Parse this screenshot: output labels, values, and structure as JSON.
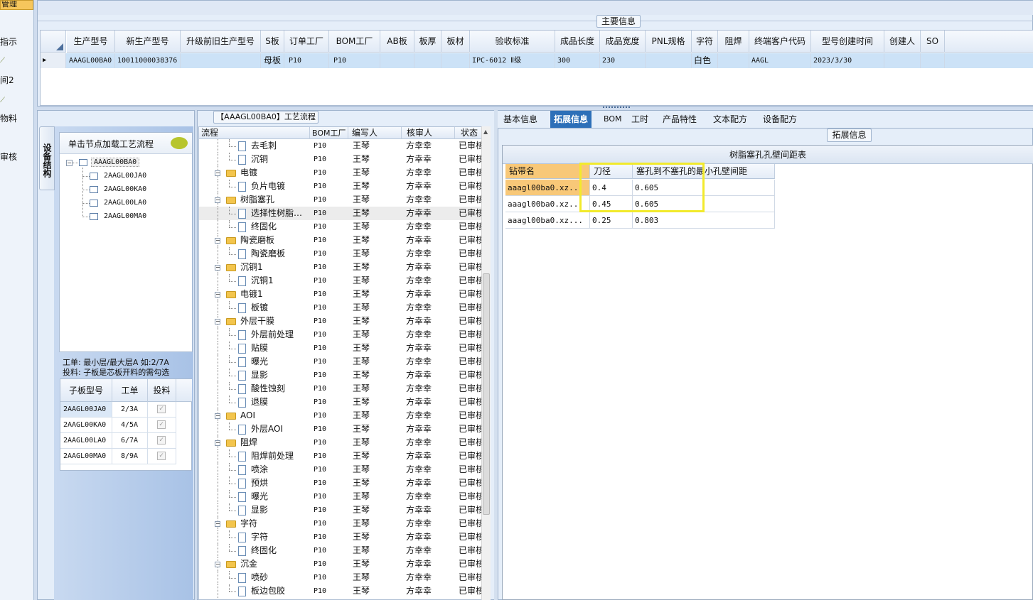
{
  "leftnav": {
    "top_label": "管理",
    "items": [
      "指示",
      "间2",
      "物料",
      "审核"
    ]
  },
  "main_info": {
    "legend": "主要信息",
    "columns": [
      "生产型号",
      "新生产型号",
      "升级前旧生产型号",
      "S板",
      "订单工厂",
      "BOM工厂",
      "AB板",
      "板厚",
      "板材",
      "验收标准",
      "成品长度",
      "成品宽度",
      "PNL规格",
      "字符",
      "阻焊",
      "终端客户代码",
      "型号创建时间",
      "创建人",
      "SO"
    ],
    "row": {
      "production_model": "AAAGL00BA0",
      "new_model": "10011000038376",
      "old_model": "",
      "s_board": "母板",
      "order_factory": "P10",
      "bom_factory": "P10",
      "ab_board": "",
      "thickness": "",
      "material": "",
      "standard": "IPC-6012 Ⅱ级",
      "length": "300",
      "width": "230",
      "pnl": "",
      "char": "白色",
      "solder_mask": "",
      "customer_code": "AAGL",
      "created_time": "2023/3/30",
      "creator": "",
      "so": ""
    }
  },
  "equipment": {
    "vertical_tab": "设备结构",
    "tree_header": "单击节点加载工艺流程",
    "root": "AAAGL00BA0",
    "children": [
      "2AAGL00JA0",
      "2AAGL00KA0",
      "2AAGL00LA0",
      "2AAGL00MA0"
    ],
    "note_line1": "工单: 最小层/最大层A 如:2/7A",
    "note_line2": "投料: 子板是芯板开料的需勾选",
    "subgrid": {
      "headers": [
        "子板型号",
        "工单",
        "投料"
      ],
      "rows": [
        {
          "model": "2AAGL00JA0",
          "order": "2/3A",
          "feed": true
        },
        {
          "model": "2AAGL00KA0",
          "order": "4/5A",
          "feed": true
        },
        {
          "model": "2AAGL00LA0",
          "order": "6/7A",
          "feed": true
        },
        {
          "model": "2AAGL00MA0",
          "order": "8/9A",
          "feed": true
        }
      ]
    }
  },
  "process": {
    "legend": "【AAAGL00BA0】工艺流程",
    "headers": [
      "流程",
      "BOM工厂",
      "编写人",
      "核审人",
      "状态"
    ],
    "rows": [
      {
        "name": "去毛刺",
        "level": 2,
        "bom": "P10",
        "writer": "王琴",
        "reviewer": "方幸幸",
        "status": "已审核"
      },
      {
        "name": "沉铜",
        "level": 2,
        "bom": "P10",
        "writer": "王琴",
        "reviewer": "方幸幸",
        "status": "已审核"
      },
      {
        "name": "电镀",
        "level": 1,
        "bom": "P10",
        "writer": "王琴",
        "reviewer": "方幸幸",
        "status": "已审核"
      },
      {
        "name": "负片电镀",
        "level": 2,
        "bom": "P10",
        "writer": "王琴",
        "reviewer": "方幸幸",
        "status": "已审核"
      },
      {
        "name": "树脂塞孔",
        "level": 1,
        "bom": "P10",
        "writer": "王琴",
        "reviewer": "方幸幸",
        "status": "已审核"
      },
      {
        "name": "选择性树脂塞孔",
        "level": 2,
        "bom": "P10",
        "writer": "王琴",
        "reviewer": "方幸幸",
        "status": "已审核",
        "selected": true
      },
      {
        "name": "终固化",
        "level": 2,
        "bom": "P10",
        "writer": "王琴",
        "reviewer": "方幸幸",
        "status": "已审核"
      },
      {
        "name": "陶瓷磨板",
        "level": 1,
        "bom": "P10",
        "writer": "王琴",
        "reviewer": "方幸幸",
        "status": "已审核"
      },
      {
        "name": "陶瓷磨板",
        "level": 2,
        "bom": "P10",
        "writer": "王琴",
        "reviewer": "方幸幸",
        "status": "已审核"
      },
      {
        "name": "沉铜1",
        "level": 1,
        "bom": "P10",
        "writer": "王琴",
        "reviewer": "方幸幸",
        "status": "已审核"
      },
      {
        "name": "沉铜1",
        "level": 2,
        "bom": "P10",
        "writer": "王琴",
        "reviewer": "方幸幸",
        "status": "已审核"
      },
      {
        "name": "电镀1",
        "level": 1,
        "bom": "P10",
        "writer": "王琴",
        "reviewer": "方幸幸",
        "status": "已审核"
      },
      {
        "name": "板镀",
        "level": 2,
        "bom": "P10",
        "writer": "王琴",
        "reviewer": "方幸幸",
        "status": "已审核"
      },
      {
        "name": "外层干膜",
        "level": 1,
        "bom": "P10",
        "writer": "王琴",
        "reviewer": "方幸幸",
        "status": "已审核"
      },
      {
        "name": "外层前处理",
        "level": 2,
        "bom": "P10",
        "writer": "王琴",
        "reviewer": "方幸幸",
        "status": "已审核"
      },
      {
        "name": "贴膜",
        "level": 2,
        "bom": "P10",
        "writer": "王琴",
        "reviewer": "方幸幸",
        "status": "已审核"
      },
      {
        "name": "曝光",
        "level": 2,
        "bom": "P10",
        "writer": "王琴",
        "reviewer": "方幸幸",
        "status": "已审核"
      },
      {
        "name": "显影",
        "level": 2,
        "bom": "P10",
        "writer": "王琴",
        "reviewer": "方幸幸",
        "status": "已审核"
      },
      {
        "name": "酸性蚀刻",
        "level": 2,
        "bom": "P10",
        "writer": "王琴",
        "reviewer": "方幸幸",
        "status": "已审核"
      },
      {
        "name": "退膜",
        "level": 2,
        "bom": "P10",
        "writer": "王琴",
        "reviewer": "方幸幸",
        "status": "已审核"
      },
      {
        "name": "AOI",
        "level": 1,
        "bom": "P10",
        "writer": "王琴",
        "reviewer": "方幸幸",
        "status": "已审核"
      },
      {
        "name": "外层AOI",
        "level": 2,
        "bom": "P10",
        "writer": "王琴",
        "reviewer": "方幸幸",
        "status": "已审核"
      },
      {
        "name": "阻焊",
        "level": 1,
        "bom": "P10",
        "writer": "王琴",
        "reviewer": "方幸幸",
        "status": "已审核"
      },
      {
        "name": "阻焊前处理",
        "level": 2,
        "bom": "P10",
        "writer": "王琴",
        "reviewer": "方幸幸",
        "status": "已审核"
      },
      {
        "name": "喷涂",
        "level": 2,
        "bom": "P10",
        "writer": "王琴",
        "reviewer": "方幸幸",
        "status": "已审核"
      },
      {
        "name": "预烘",
        "level": 2,
        "bom": "P10",
        "writer": "王琴",
        "reviewer": "方幸幸",
        "status": "已审核"
      },
      {
        "name": "曝光",
        "level": 2,
        "bom": "P10",
        "writer": "王琴",
        "reviewer": "方幸幸",
        "status": "已审核"
      },
      {
        "name": "显影",
        "level": 2,
        "bom": "P10",
        "writer": "王琴",
        "reviewer": "方幸幸",
        "status": "已审核"
      },
      {
        "name": "字符",
        "level": 1,
        "bom": "P10",
        "writer": "王琴",
        "reviewer": "方幸幸",
        "status": "已审核"
      },
      {
        "name": "字符",
        "level": 2,
        "bom": "P10",
        "writer": "王琴",
        "reviewer": "方幸幸",
        "status": "已审核"
      },
      {
        "name": "终固化",
        "level": 2,
        "bom": "P10",
        "writer": "王琴",
        "reviewer": "方幸幸",
        "status": "已审核"
      },
      {
        "name": "沉金",
        "level": 1,
        "bom": "P10",
        "writer": "王琴",
        "reviewer": "方幸幸",
        "status": "已审核"
      },
      {
        "name": "喷砂",
        "level": 2,
        "bom": "P10",
        "writer": "王琴",
        "reviewer": "方幸幸",
        "status": "已审核"
      },
      {
        "name": "板边包胶",
        "level": 2,
        "bom": "P10",
        "writer": "王琴",
        "reviewer": "方幸幸",
        "status": "已审核"
      }
    ]
  },
  "right": {
    "tabs": [
      "基本信息",
      "拓展信息",
      "BOM",
      "工时",
      "产品特性",
      "文本配方",
      "设备配方"
    ],
    "active_tab": 1,
    "legend": "拓展信息",
    "table_title": "树脂塞孔孔壁间距表",
    "headers": [
      "钻带名",
      "刀径",
      "塞孔到不塞孔的最小孔壁间距"
    ],
    "rows": [
      {
        "drill": "aaagl00ba0.xz...",
        "dia": "0.4",
        "spacing": "0.605"
      },
      {
        "drill": "aaagl00ba0.xz...",
        "dia": "0.45",
        "spacing": "0.605"
      },
      {
        "drill": "aaagl00ba0.xz...",
        "dia": "0.25",
        "spacing": "0.803"
      }
    ]
  },
  "colors": {
    "accent_tab": "#2d6fb8",
    "highlight_box": "#f2ea2c",
    "selected_row": "#cce2f7",
    "header_highlight": "#f8c878"
  }
}
